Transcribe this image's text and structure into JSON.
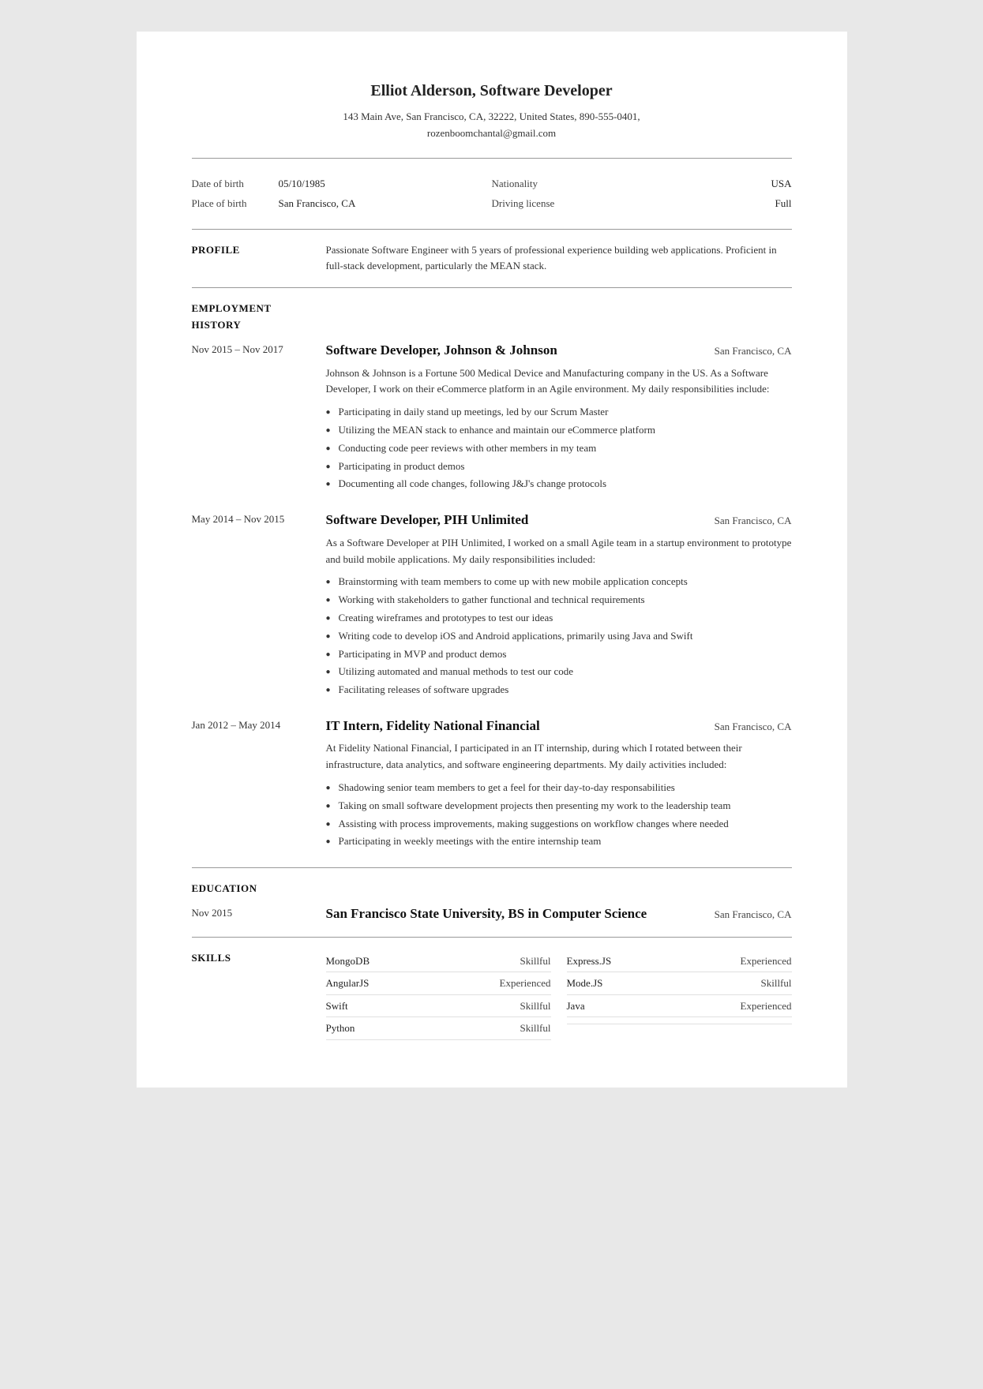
{
  "header": {
    "name": "Elliot Alderson, Software Developer",
    "address": "143 Main Ave, San Francisco, CA, 32222, United States, 890-555-0401,",
    "email": "rozenboomchantal@gmail.com"
  },
  "personal": {
    "dob_label": "Date of birth",
    "dob_value": "05/10/1985",
    "pob_label": "Place of birth",
    "pob_value": "San Francisco, CA",
    "nationality_label": "Nationality",
    "nationality_value": "USA",
    "driving_label": "Driving license",
    "driving_value": "Full"
  },
  "profile": {
    "section_title": "PROFILE",
    "text": "Passionate Software Engineer with 5 years of professional experience building web applications. Proficient in full-stack development, particularly the MEAN stack."
  },
  "employment": {
    "section_title": "EMPLOYMENT HISTORY",
    "jobs": [
      {
        "date": "Nov 2015 – Nov 2017",
        "title": "Software Developer, Johnson & Johnson",
        "location": "San Francisco, CA",
        "desc": "Johnson & Johnson is a Fortune 500 Medical Device and Manufacturing company in the US. As a Software Developer, I work on their eCommerce platform in an Agile environment. My daily responsibilities include:",
        "bullets": [
          "Participating in daily stand up meetings, led by our Scrum Master",
          "Utilizing the MEAN stack to enhance and maintain our eCommerce platform",
          "Conducting code peer reviews with other members in my team",
          "Participating in product demos",
          "Documenting all code changes, following J&J's change protocols"
        ]
      },
      {
        "date": "May 2014 – Nov 2015",
        "title": "Software Developer, PIH Unlimited",
        "location": "San Francisco, CA",
        "desc": "As a Software Developer at PIH Unlimited, I worked on a small Agile team in a startup environment to prototype and build mobile applications. My daily responsibilities included:",
        "bullets": [
          "Brainstorming with team members to come up with new mobile application concepts",
          "Working with stakeholders to gather functional and technical requirements",
          "Creating wireframes and prototypes to test our ideas",
          "Writing code to develop iOS and Android applications, primarily using Java and Swift",
          "Participating in MVP and product demos",
          "Utilizing automated and manual methods to test our code",
          "Facilitating releases of software upgrades"
        ]
      },
      {
        "date": "Jan 2012 – May 2014",
        "title": "IT Intern, Fidelity National Financial",
        "location": "San Francisco, CA",
        "desc": "At Fidelity National Financial, I participated in an IT internship, during which I rotated between their infrastructure, data analytics, and software engineering departments. My daily activities included:",
        "bullets": [
          "Shadowing senior team members to get a feel for their day-to-day responsabilities",
          "Taking on small software development projects then presenting my work to the leadership team",
          "Assisting with process improvements, making suggestions on workflow changes where needed",
          "Participating in weekly meetings with the entire internship team"
        ]
      }
    ]
  },
  "education": {
    "section_title": "EDUCATION",
    "entries": [
      {
        "date": "Nov 2015",
        "title": "San Francisco State University, BS in Computer Science",
        "location": "San Francisco, CA"
      }
    ]
  },
  "skills": {
    "section_title": "SKILLS",
    "items": [
      {
        "name": "MongoDB",
        "level": "Skillful"
      },
      {
        "name": "Express.JS",
        "level": "Experienced"
      },
      {
        "name": "AngularJS",
        "level": "Experienced"
      },
      {
        "name": "Mode.JS",
        "level": "Skillful"
      },
      {
        "name": "Swift",
        "level": "Skillful"
      },
      {
        "name": "Java",
        "level": "Experienced"
      },
      {
        "name": "Python",
        "level": "Skillful"
      },
      {
        "name": "",
        "level": ""
      }
    ]
  }
}
